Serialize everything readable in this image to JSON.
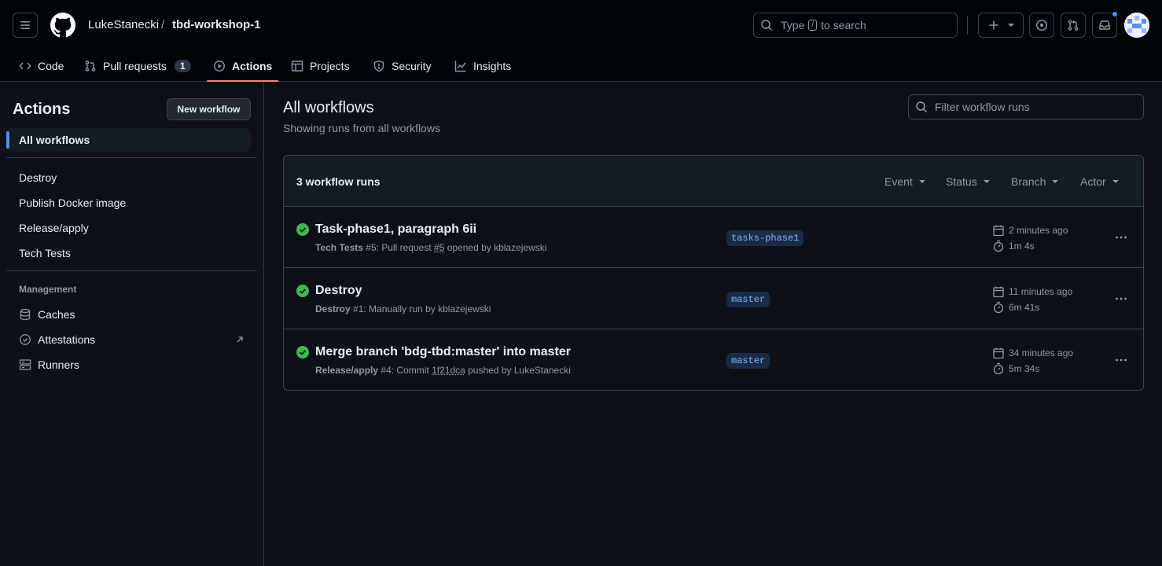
{
  "header": {
    "owner": "LukeStanecki",
    "separator": "/",
    "repo": "tbd-workshop-1",
    "search": {
      "prefix": "Type",
      "key": "/",
      "suffix": "to search"
    }
  },
  "tabs": [
    {
      "label": "Code",
      "icon": "code-icon"
    },
    {
      "label": "Pull requests",
      "icon": "git-pull-request-icon",
      "count": "1"
    },
    {
      "label": "Actions",
      "icon": "play-icon",
      "selected": true
    },
    {
      "label": "Projects",
      "icon": "table-icon"
    },
    {
      "label": "Security",
      "icon": "shield-icon"
    },
    {
      "label": "Insights",
      "icon": "graph-icon"
    }
  ],
  "sidebar": {
    "title": "Actions",
    "new_workflow": "New workflow",
    "all_workflows": "All workflows",
    "workflows": [
      "Destroy",
      "Publish Docker image",
      "Release/apply",
      "Tech Tests"
    ],
    "management_heading": "Management",
    "management": [
      {
        "label": "Caches",
        "icon": "database-icon"
      },
      {
        "label": "Attestations",
        "icon": "verified-icon",
        "external": true
      },
      {
        "label": "Runners",
        "icon": "server-icon"
      }
    ]
  },
  "main": {
    "title": "All workflows",
    "subtitle": "Showing runs from all workflows",
    "filter_placeholder": "Filter workflow runs",
    "runs_count": "3 workflow runs",
    "filters": [
      "Event",
      "Status",
      "Branch",
      "Actor"
    ],
    "runs": [
      {
        "title": "Task-phase1, paragraph 6ii",
        "workflow": "Tech Tests",
        "run_number": "#5",
        "meta_mid": ": Pull request ",
        "ref": "#5",
        "meta_tail": " opened by kblazejewski",
        "branch": "tasks-phase1",
        "when": "2 minutes ago",
        "duration": "1m 4s",
        "status": "success"
      },
      {
        "title": "Destroy",
        "workflow": "Destroy",
        "run_number": "#1",
        "meta_mid": ": Manually run by kblazejewski",
        "ref": "",
        "meta_tail": "",
        "branch": "master",
        "when": "11 minutes ago",
        "duration": "6m 41s",
        "status": "success"
      },
      {
        "title": "Merge branch 'bdg-tbd:master' into master",
        "workflow": "Release/apply",
        "run_number": "#4",
        "meta_mid": ": Commit ",
        "ref": "1f21dca",
        "meta_tail": " pushed by LukeStanecki",
        "branch": "master",
        "when": "34 minutes ago",
        "duration": "5m 34s",
        "status": "success"
      }
    ]
  },
  "colors": {
    "accent_tab": "#f78166",
    "success": "#3fb950",
    "branch_text": "#79b8ff",
    "active_marker": "#4493f8"
  }
}
